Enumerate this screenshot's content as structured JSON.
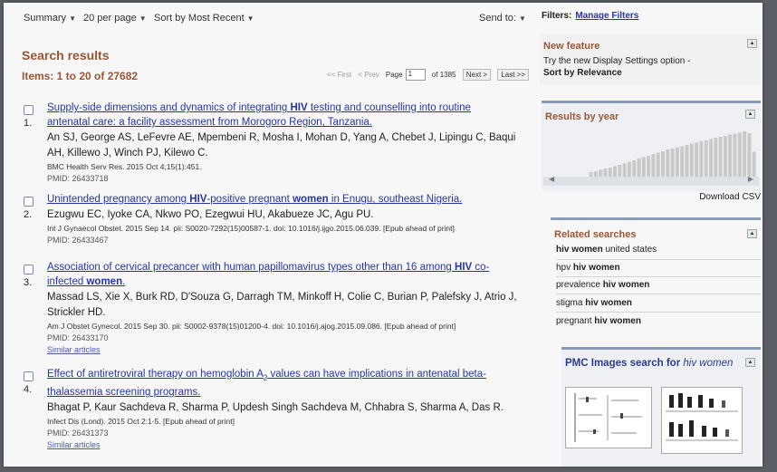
{
  "toolbar": {
    "summary": "Summary",
    "per_page": "20 per page",
    "sort": "Sort by Most Recent",
    "send_to": "Send to:"
  },
  "header": {
    "title": "Search results",
    "items": "Items: 1 to 20 of 27682"
  },
  "pager": {
    "first": "<< First",
    "prev": "< Prev",
    "page_label": "Page",
    "page_value": "1",
    "of": "of 1385",
    "next": "Next >",
    "last": "Last >>"
  },
  "results": [
    {
      "num": "1.",
      "title_parts": [
        "Supply-side dimensions and dynamics of integrating ",
        "HIV",
        " testing and counselling into routine",
        "antenatal care: a facility assessment from Morogoro Region, Tanzania."
      ],
      "authors": [
        "An SJ, George AS, LeFevre AE, Mpembeni R, Mosha I, Mohan D, Yang A, Chebet J, Lipingu C, Baqui",
        "AH, Killewo J, Winch PJ, Kilewo C."
      ],
      "journal": "BMC Health Serv Res. 2015 Oct 4;15(1):451.",
      "pmid": "PMID: 26433718"
    },
    {
      "num": "2.",
      "title_parts": [
        "Unintended pregnancy among ",
        "HIV",
        "-positive pregnant ",
        "women",
        " in Enugu, southeast Nigeria."
      ],
      "authors": [
        "Ezugwu EC, Iyoke CA, Nkwo PO, Ezegwui HU, Akabueze JC, Agu PU."
      ],
      "journal": "Int J Gynaecol Obstet. 2015 Sep 14. pii: S0020-7292(15)00587-1. doi: 10.1016/j.ijgo.2015.06.039. [Epub ahead of print]",
      "pmid": "PMID: 26433467"
    },
    {
      "num": "3.",
      "title_parts": [
        "Association of cervical precancer with human papillomavirus types other than 16 among ",
        "HIV",
        " co-",
        "infected ",
        "women",
        "."
      ],
      "authors": [
        "Massad LS, Xie X, Burk RD, D'Souza G, Darragh TM, Minkoff H, Colie C, Burian P, Palefsky J, Atrio J,",
        "Strickler HD."
      ],
      "journal": "Am J Obstet Gynecol. 2015 Sep 30. pii: S0002-9378(15)01200-4. doi: 10.1016/j.ajog.2015.09.086. [Epub ahead of print]",
      "pmid": "PMID: 26433170",
      "similar": "Similar articles"
    },
    {
      "num": "4.",
      "title_parts": [
        "Effect of antiretroviral therapy on hemoglobin A",
        "2",
        " values can have implications in antenatal beta-",
        "thalassemia screening programs."
      ],
      "authors": [
        "Bhagat P, Kaur Sachdeva R, Sharma P, Updesh Singh Sachdeva M, Chhabra S, Sharma A, Das R."
      ],
      "journal": "Infect Dis (Lond). 2015 Oct 2:1-5. [Epub ahead of print]",
      "pmid": "PMID: 26431373",
      "similar": "Similar articles"
    }
  ],
  "sidebar": {
    "filters_label": "Filters:",
    "manage_filters": "Manage Filters",
    "new_feature": {
      "title": "New feature",
      "text": "Try the new Display Settings option -",
      "link": "Sort by Relevance"
    },
    "results_by_year": {
      "title": "Results by year",
      "download": "Download CSV",
      "bar_levels": [
        0.1,
        0.12,
        0.15,
        0.18,
        0.2,
        0.23,
        0.26,
        0.3,
        0.33,
        0.36,
        0.4,
        0.43,
        0.46,
        0.5,
        0.53,
        0.56,
        0.6,
        0.62,
        0.65,
        0.67,
        0.7,
        0.73,
        0.75,
        0.78,
        0.8,
        0.83,
        0.86,
        0.88,
        0.9,
        0.93,
        0.95,
        0.97,
        1.0,
        0.96,
        0.55
      ]
    },
    "related": {
      "title": "Related searches",
      "items": [
        {
          "pre": "hiv women",
          "bold": "",
          "post": " united states"
        },
        {
          "pre": "hpv ",
          "bold": "hiv women",
          "post": ""
        },
        {
          "pre": "prevalence ",
          "bold": "hiv women",
          "post": ""
        },
        {
          "pre": "stigma ",
          "bold": "hiv women",
          "post": ""
        },
        {
          "pre": "pregnant ",
          "bold": "hiv women",
          "post": ""
        }
      ]
    },
    "pmc": {
      "title_pre": "PMC Images search for ",
      "title_query": "hiv women"
    }
  },
  "colors": {
    "link": "#2636a8",
    "heading": "#985735",
    "histogram_bar": "#c9c9c9"
  }
}
